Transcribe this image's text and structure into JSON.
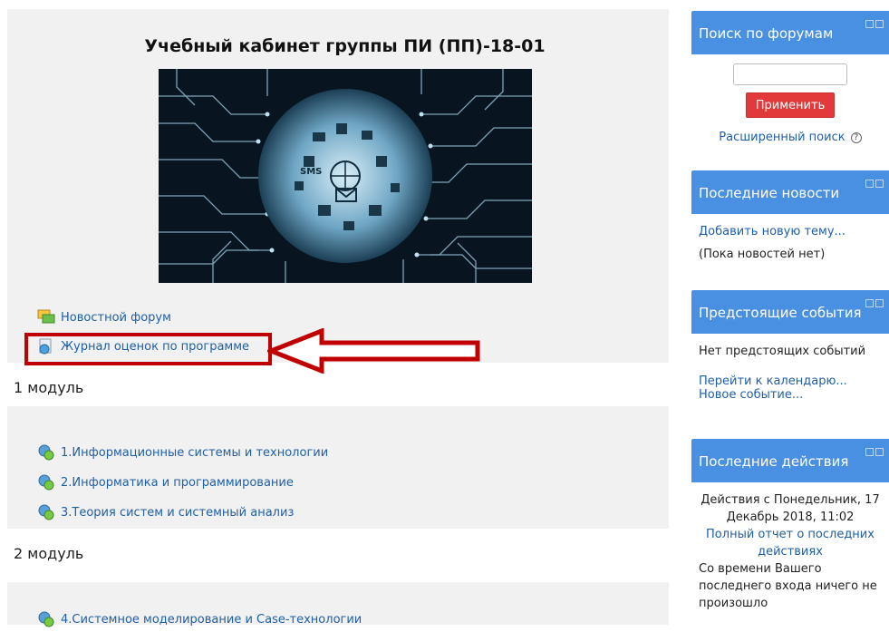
{
  "course": {
    "title": "Учебный кабинет группы ПИ (ПП)-18-01",
    "banner_icons": [
      "SMS"
    ],
    "news_forum": "Новостной форум",
    "grades_journal": "Журнал оценок по программе"
  },
  "sections": [
    {
      "title": "1 модуль",
      "items": [
        "1.Информационные системы и технологии",
        "2.Информатика и программирование",
        "3.Теория систем и системный анализ"
      ]
    },
    {
      "title": "2 модуль",
      "items": [
        "4.Системное моделирование и Case-технологии"
      ]
    }
  ],
  "blocks": {
    "search": {
      "title": "Поиск по форумам",
      "input_value": "",
      "apply": "Применить",
      "advanced": "Расширенный поиск"
    },
    "news": {
      "title": "Последние новости",
      "add_topic": "Добавить новую тему...",
      "empty": "(Пока новостей нет)"
    },
    "events": {
      "title": "Предстоящие события",
      "empty": "Нет предстоящих событий",
      "calendar": "Перейти к календарю...",
      "new_event": "Новое событие..."
    },
    "activity": {
      "title": "Последние действия",
      "since": "Действия с Понедельник, 17 Декабрь 2018, 11:02",
      "full_report": "Полный отчет о последних действиях",
      "nothing": "Со времени Вашего последнего входа ничего не произошло"
    }
  },
  "colors": {
    "block_header": "#4a90e2",
    "link": "#1f5fa6",
    "button": "#e23a3a",
    "highlight": "#c00000",
    "panel": "#f1f1f1"
  }
}
